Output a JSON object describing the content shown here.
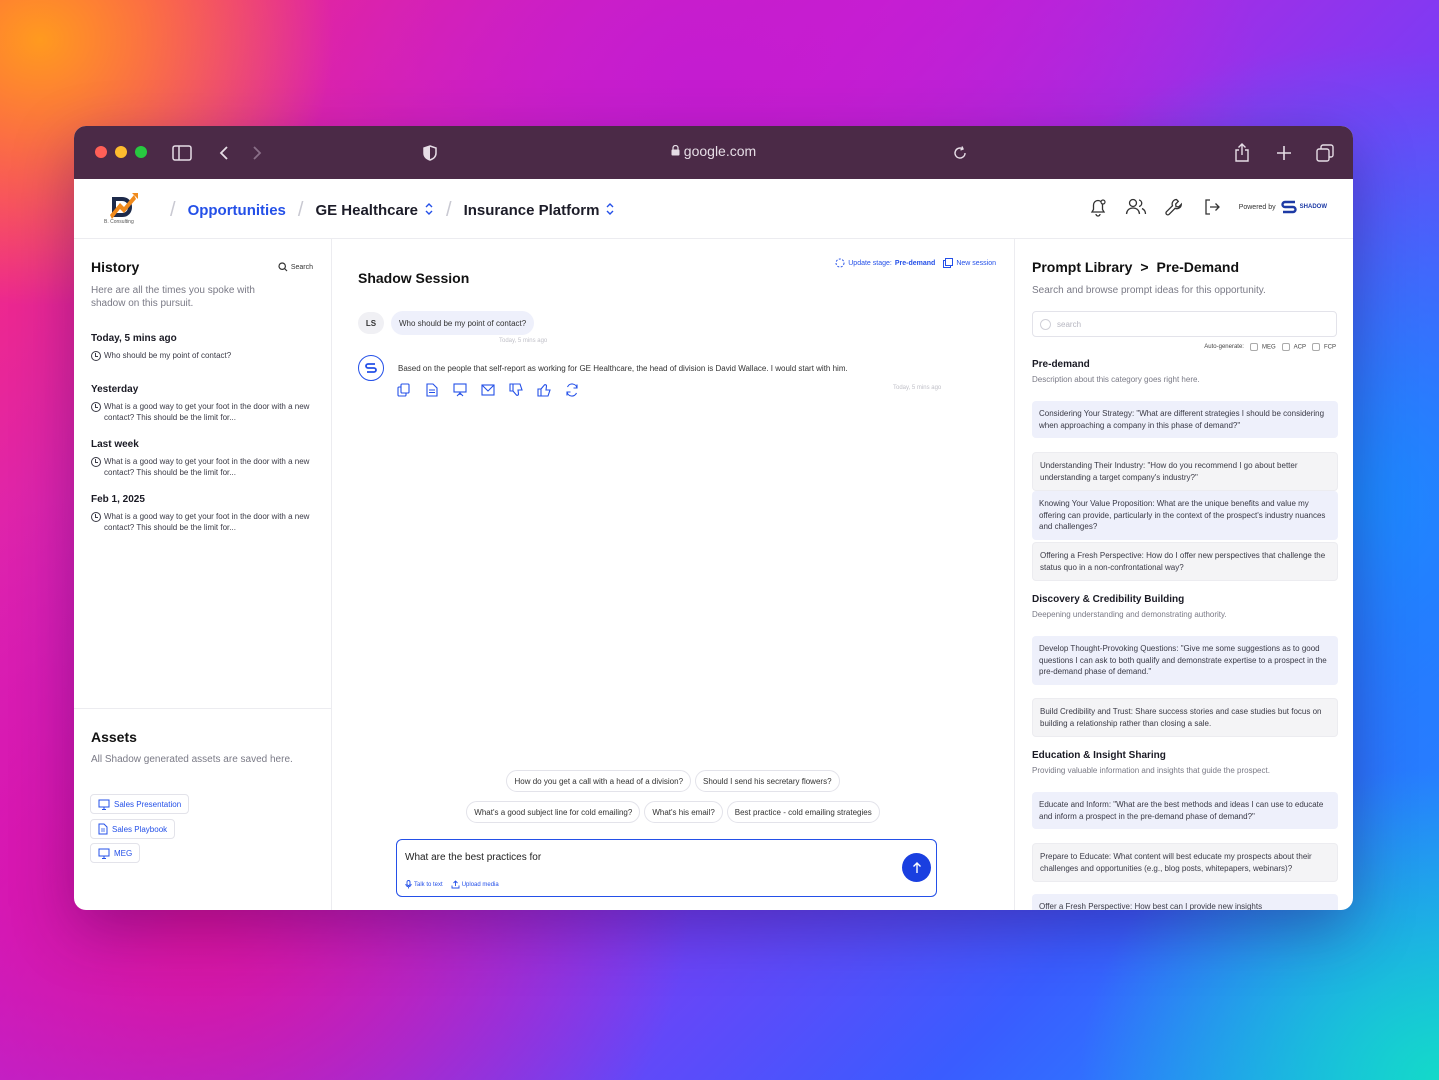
{
  "browser": {
    "url": "google.com"
  },
  "header": {
    "logo_text": "B. Consulting",
    "breadcrumbs": [
      "Opportunities",
      "GE Healthcare",
      "Insurance Platform"
    ],
    "powered_by": "Powered by",
    "brand": "SHADOW"
  },
  "history": {
    "title": "History",
    "search_label": "Search",
    "description": "Here are all the times you spoke with shadow on this pursuit.",
    "groups": [
      {
        "date": "Today, 5 mins ago",
        "item": "Who should be my point of contact?"
      },
      {
        "date": "Yesterday",
        "item": "What is a good way to get your foot in the door with a new contact? This should be the limit for..."
      },
      {
        "date": "Last week",
        "item": "What is a good way to get your foot in the door with a new contact? This should be the limit for..."
      },
      {
        "date": "Feb 1, 2025",
        "item": "What is a good way to get your foot in the door with a new contact? This should be the limit for..."
      }
    ]
  },
  "assets": {
    "title": "Assets",
    "description": "All Shadow generated assets are saved here.",
    "items": [
      "Sales Presentation",
      "Sales Playbook",
      "MEG"
    ]
  },
  "session": {
    "title": "Shadow Session",
    "update_stage_label": "Update stage:",
    "update_stage_value": "Pre-demand",
    "new_session": "New session",
    "user_initials": "LS",
    "user_message": "Who should be my point of contact?",
    "user_time": "Today, 5 mins ago",
    "ai_message": "Based on the people that self-report as working for GE Healthcare, the head of division is David Wallace. I would start with him.",
    "ai_time": "Today, 5 mins ago",
    "suggestions_row1": [
      "How do you get a call with a head of a division?",
      "Should I send his secretary flowers?"
    ],
    "suggestions_row2": [
      "What's a good subject line for cold emailing?",
      "What's his email?",
      "Best practice - cold emailing strategies"
    ],
    "composer_value": "What are the best practices for",
    "talk_to_text": "Talk to text",
    "upload_media": "Upload media"
  },
  "library": {
    "title": "Prompt Library",
    "arrow": ">",
    "stage": "Pre-Demand",
    "description": "Search and browse prompt ideas for this opportunity.",
    "search_placeholder": "search",
    "autogen_label": "Auto-generate:",
    "autogen_options": [
      "MEG",
      "ACP",
      "FCP"
    ],
    "categories": [
      {
        "title": "Pre-demand",
        "description": "Description about this category goes right here.",
        "prompts": [
          "Considering Your Strategy: \"What are different strategies I should be considering when approaching a company in this phase of demand?\"",
          "Understanding Their Industry: \"How do you recommend I go about better understanding a target company's industry?\"",
          "Knowing Your Value Proposition: What are the unique benefits and value my offering can provide, particularly in the context of the prospect's industry nuances and challenges?",
          "Offering a Fresh Perspective: How do I offer new perspectives that challenge the status quo in a non-confrontational way?"
        ]
      },
      {
        "title": "Discovery & Credibility Building",
        "description": "Deepening understanding and demonstrating authority.",
        "prompts": [
          "Develop Thought-Provoking Questions: \"Give me some suggestions as to good questions I can ask to both qualify and demonstrate expertise to a prospect in the pre-demand phase of demand.\"",
          "Build Credibility and Trust: Share success stories and case studies but focus on building a relationship rather than closing a sale."
        ]
      },
      {
        "title": "Education & Insight Sharing",
        "description": "Providing valuable information and insights that guide the prospect.",
        "prompts": [
          "Educate and Inform: \"What are the best methods and ideas I can use to educate and inform a prospect in the pre-demand phase of demand?\"",
          "Prepare to Educate: What content will best educate my prospects about their challenges and opportunities (e.g., blog posts, whitepapers, webinars)?",
          "Offer a Fresh Perspective: How best can I provide new insights"
        ]
      }
    ]
  }
}
